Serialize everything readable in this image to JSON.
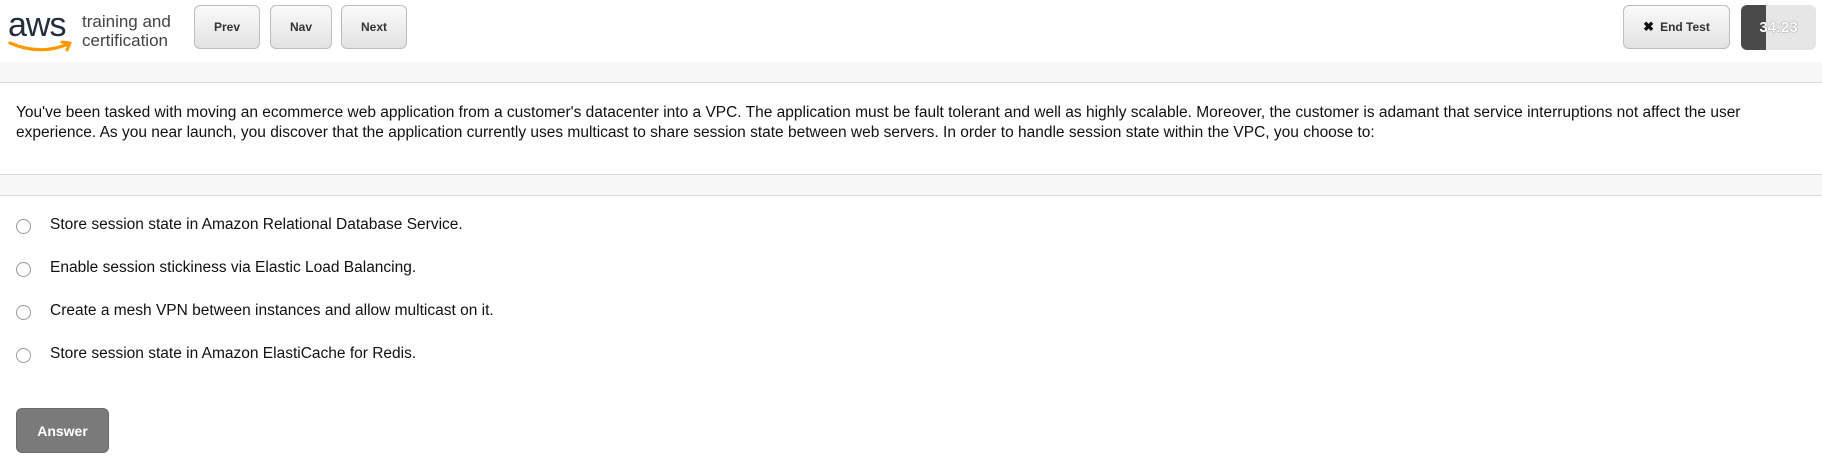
{
  "brand": {
    "logo_text": "aws",
    "tagline_line1": "training and",
    "tagline_line2": "certification",
    "accent_color": "#ff9900"
  },
  "toolbar": {
    "prev_label": "Prev",
    "nav_label": "Nav",
    "next_label": "Next",
    "end_test_label": "End Test",
    "end_test_icon": "close-icon"
  },
  "timer": {
    "value": "34:23",
    "progress_fraction": 0.33
  },
  "question": {
    "text": "You've been tasked with moving an ecommerce web application from a customer's datacenter into a VPC.  The application must be fault tolerant and well as highly scalable.  Moreover, the customer is adamant that service interruptions not affect the user experience.  As you near launch, you discover that the application currently uses multicast to share session state between web servers.  In order to handle session state within the VPC, you choose to:"
  },
  "options": [
    {
      "label": "Store session state in Amazon Relational Database Service."
    },
    {
      "label": "Enable session stickiness via Elastic Load Balancing."
    },
    {
      "label": "Create a mesh VPN between instances and allow multicast on it."
    },
    {
      "label": "Store session state in Amazon ElastiCache for Redis."
    }
  ],
  "answer_button": {
    "label": "Answer"
  }
}
